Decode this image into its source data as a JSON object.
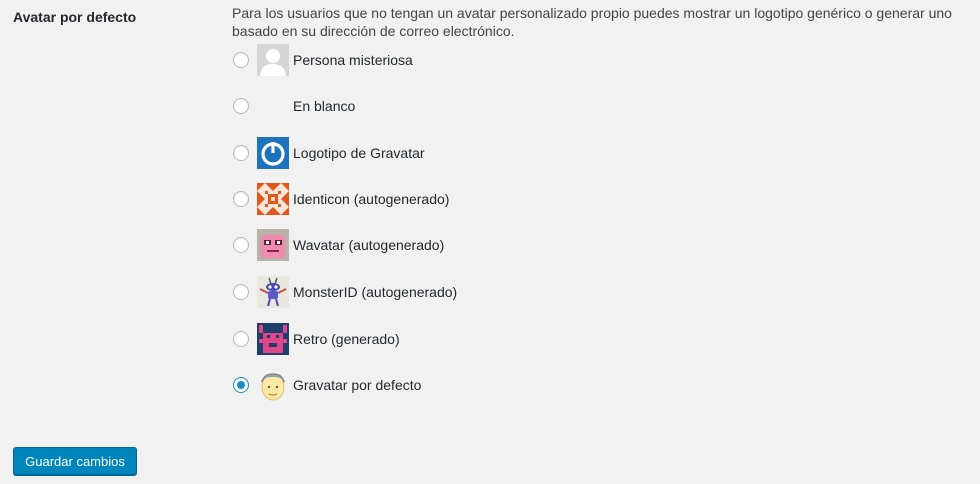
{
  "section": {
    "heading": "Avatar por defecto",
    "description": "Para los usuarios que no tengan un avatar personalizado propio puedes mostrar un logotipo genérico o generar uno basado en su dirección de correo electrónico."
  },
  "options": [
    {
      "label": "Persona misteriosa",
      "icon": "mystery-person-avatar",
      "checked": false
    },
    {
      "label": "En blanco",
      "icon": "blank-avatar",
      "checked": false
    },
    {
      "label": "Logotipo de Gravatar",
      "icon": "gravatar-logo-avatar",
      "checked": false
    },
    {
      "label": "Identicon (autogenerado)",
      "icon": "identicon-avatar",
      "checked": false
    },
    {
      "label": "Wavatar (autogenerado)",
      "icon": "wavatar-avatar",
      "checked": false
    },
    {
      "label": "MonsterID (autogenerado)",
      "icon": "monsterid-avatar",
      "checked": false
    },
    {
      "label": "Retro (generado)",
      "icon": "retro-avatar",
      "checked": false
    },
    {
      "label": "Gravatar por defecto",
      "icon": "default-gravatar-avatar",
      "checked": true
    }
  ],
  "save_button": {
    "label": "Guardar cambios"
  },
  "colors": {
    "accent": "#0085ba",
    "radio_checked": "#1e8cbe",
    "background": "#f1f1f1"
  }
}
